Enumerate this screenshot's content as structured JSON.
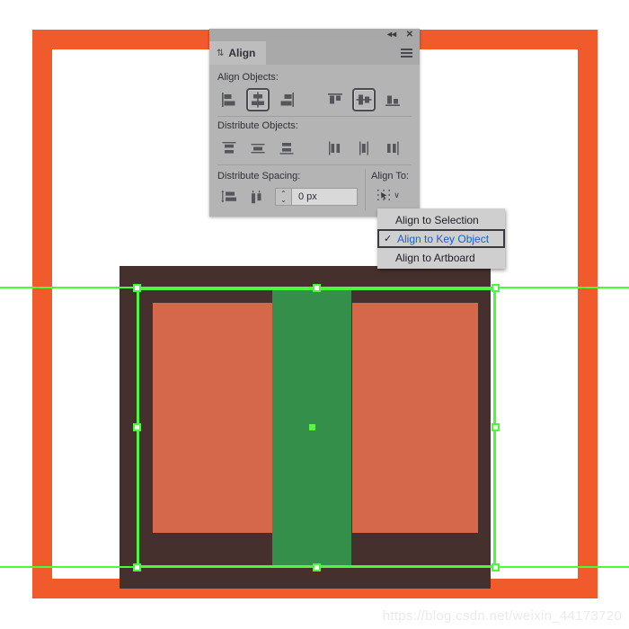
{
  "panel": {
    "title": "Align",
    "topbar": {
      "collapse_icon": "collapse-double-arrow-icon",
      "close_icon": "close-icon",
      "collapse_glyph": "◂◂",
      "close_glyph": "✕"
    },
    "menu_icon": "panel-menu-hamburger-icon",
    "tab_grip_glyph": "⇅",
    "sections": {
      "align_objects": {
        "label": "Align Objects:",
        "buttons": [
          {
            "name": "horizontal-align-left",
            "selected": false
          },
          {
            "name": "horizontal-align-center",
            "selected": true
          },
          {
            "name": "horizontal-align-right",
            "selected": false
          },
          {
            "name": "vertical-align-top",
            "selected": false
          },
          {
            "name": "vertical-align-center",
            "selected": true
          },
          {
            "name": "vertical-align-bottom",
            "selected": false
          }
        ]
      },
      "distribute_objects": {
        "label": "Distribute Objects:",
        "buttons": [
          {
            "name": "vertical-distribute-top",
            "selected": false
          },
          {
            "name": "vertical-distribute-center",
            "selected": false
          },
          {
            "name": "vertical-distribute-bottom",
            "selected": false
          },
          {
            "name": "horizontal-distribute-left",
            "selected": false
          },
          {
            "name": "horizontal-distribute-center",
            "selected": false
          },
          {
            "name": "horizontal-distribute-right",
            "selected": false
          }
        ]
      },
      "distribute_spacing": {
        "label": "Distribute Spacing:",
        "buttons": [
          {
            "name": "vertical-distribute-space",
            "selected": false
          },
          {
            "name": "horizontal-distribute-space",
            "selected": false
          }
        ],
        "spacing_value": "0 px",
        "spacing_placeholder": "0 px",
        "stepper_up_glyph": "⌃",
        "stepper_down_glyph": "⌄"
      },
      "align_to": {
        "label": "Align To:",
        "button_icon": "align-to-key-object-icon",
        "chevron_glyph": "∨"
      }
    }
  },
  "dropdown": {
    "items": [
      {
        "label": "Align to Selection",
        "checked": false,
        "active": false
      },
      {
        "label": "Align to Key Object",
        "checked": true,
        "active": true
      },
      {
        "label": "Align to Artboard",
        "checked": false,
        "active": false
      }
    ],
    "check_glyph": "✓"
  },
  "artwork": {
    "frame_color": "#f15a2b",
    "dark_color": "#46302e",
    "red_color": "#d5684a",
    "green_color": "#338f4a",
    "guide_color": "#49ff3a",
    "selection_color": "#4cf73c"
  },
  "watermark": {
    "text": "https://blog.csdn.net/weixin_44173720"
  }
}
